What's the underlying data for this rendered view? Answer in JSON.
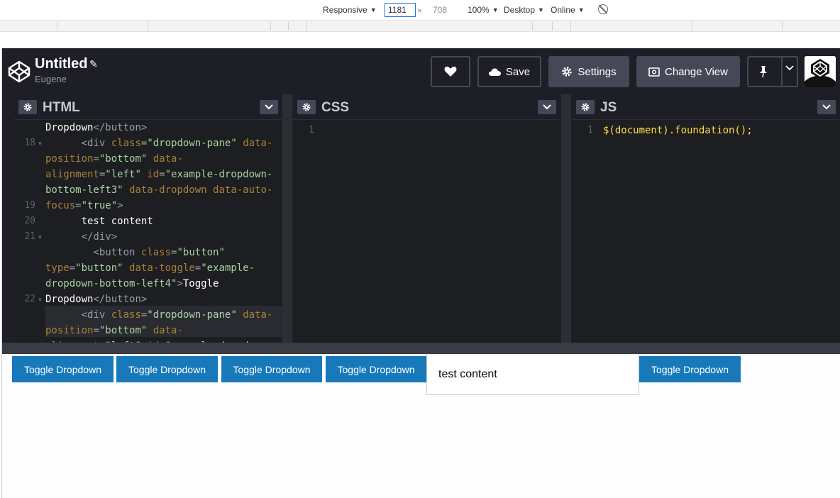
{
  "devtools": {
    "device": "Responsive",
    "width": "1181",
    "height": "708",
    "zoom": "100%",
    "mode": "Desktop",
    "network": "Online"
  },
  "header": {
    "title": "Untitled",
    "author": "Eugene",
    "save_label": "Save",
    "settings_label": "Settings",
    "change_view_label": "Change View"
  },
  "editors": {
    "html": {
      "title": "HTML",
      "line_numbers": [
        "",
        "18",
        "",
        "",
        "",
        "19",
        "20",
        "21",
        "",
        "",
        "",
        "22",
        "",
        ""
      ],
      "lines": [
        [
          [
            "t-txt",
            "Dropdown"
          ],
          [
            "t-tag",
            "</button>"
          ]
        ],
        [
          [
            "t-txt",
            "      "
          ],
          [
            "t-tag",
            "<div "
          ],
          [
            "t-attr",
            "class"
          ],
          [
            "t-tag",
            "="
          ],
          [
            "t-strv",
            "\"dropdown-pane\""
          ],
          [
            "t-txt",
            " "
          ],
          [
            "t-attr",
            "data-"
          ]
        ],
        [
          [
            "t-attr",
            "position"
          ],
          [
            "t-tag",
            "="
          ],
          [
            "t-strv",
            "\"bottom\""
          ],
          [
            "t-txt",
            " "
          ],
          [
            "t-attr",
            "data-"
          ]
        ],
        [
          [
            "t-attr",
            "alignment"
          ],
          [
            "t-tag",
            "="
          ],
          [
            "t-strv",
            "\"left\""
          ],
          [
            "t-txt",
            " "
          ],
          [
            "t-attr",
            "id"
          ],
          [
            "t-tag",
            "="
          ],
          [
            "t-strv",
            "\"example-dropdown-"
          ]
        ],
        [
          [
            "t-strv",
            "bottom-left3\""
          ],
          [
            "t-txt",
            " "
          ],
          [
            "t-attr",
            "data-dropdown"
          ],
          [
            "t-txt",
            " "
          ],
          [
            "t-attr",
            "data-auto-"
          ]
        ],
        [
          [
            "t-attr",
            "focus"
          ],
          [
            "t-tag",
            "="
          ],
          [
            "t-strv",
            "\"true\""
          ],
          [
            "t-tag",
            ">"
          ]
        ],
        [
          [
            "t-txt",
            "      test content"
          ]
        ],
        [
          [
            "t-txt",
            "      "
          ],
          [
            "t-tag",
            "</div>"
          ]
        ],
        [
          [
            "t-txt",
            "        "
          ],
          [
            "t-tag",
            "<button "
          ],
          [
            "t-attr",
            "class"
          ],
          [
            "t-tag",
            "="
          ],
          [
            "t-strv",
            "\"button\""
          ]
        ],
        [
          [
            "t-attr",
            "type"
          ],
          [
            "t-tag",
            "="
          ],
          [
            "t-strv",
            "\"button\""
          ],
          [
            "t-txt",
            " "
          ],
          [
            "t-attr",
            "data-toggle"
          ],
          [
            "t-tag",
            "="
          ],
          [
            "t-strv",
            "\"example-"
          ]
        ],
        [
          [
            "t-strv",
            "dropdown-bottom-left4\""
          ],
          [
            "t-tag",
            ">"
          ],
          [
            "t-txt",
            "Toggle"
          ]
        ],
        [
          [
            "t-txt",
            "Dropdown"
          ],
          [
            "t-tag",
            "</button>"
          ]
        ],
        [
          [
            "t-txt",
            "      "
          ],
          [
            "t-tag",
            "<div "
          ],
          [
            "t-attr",
            "class"
          ],
          [
            "t-tag",
            "="
          ],
          [
            "t-strv",
            "\"dropdown-pane\""
          ],
          [
            "t-txt",
            " "
          ],
          [
            "t-attr",
            "data-"
          ]
        ],
        [
          [
            "t-attr",
            "position"
          ],
          [
            "t-tag",
            "="
          ],
          [
            "t-strv",
            "\"bottom\""
          ],
          [
            "t-txt",
            " "
          ],
          [
            "t-attr",
            "data-"
          ]
        ],
        [
          [
            "t-attr",
            "alignment"
          ],
          [
            "t-tag",
            "="
          ],
          [
            "t-strv",
            "\"left\""
          ],
          [
            "t-txt",
            " "
          ],
          [
            "t-attr",
            "id"
          ],
          [
            "t-tag",
            "="
          ],
          [
            "t-strv",
            "\"example-dropdown-"
          ]
        ]
      ]
    },
    "css": {
      "title": "CSS",
      "line_number": "1"
    },
    "js": {
      "title": "JS",
      "line_number": "1",
      "code": "$(document).foundation();"
    }
  },
  "preview": {
    "buttons": [
      "Toggle Dropdown",
      "Toggle Dropdown",
      "Toggle Dropdown",
      "Toggle Dropdown",
      "Toggle Dropdown"
    ],
    "pane_text": "test content"
  }
}
